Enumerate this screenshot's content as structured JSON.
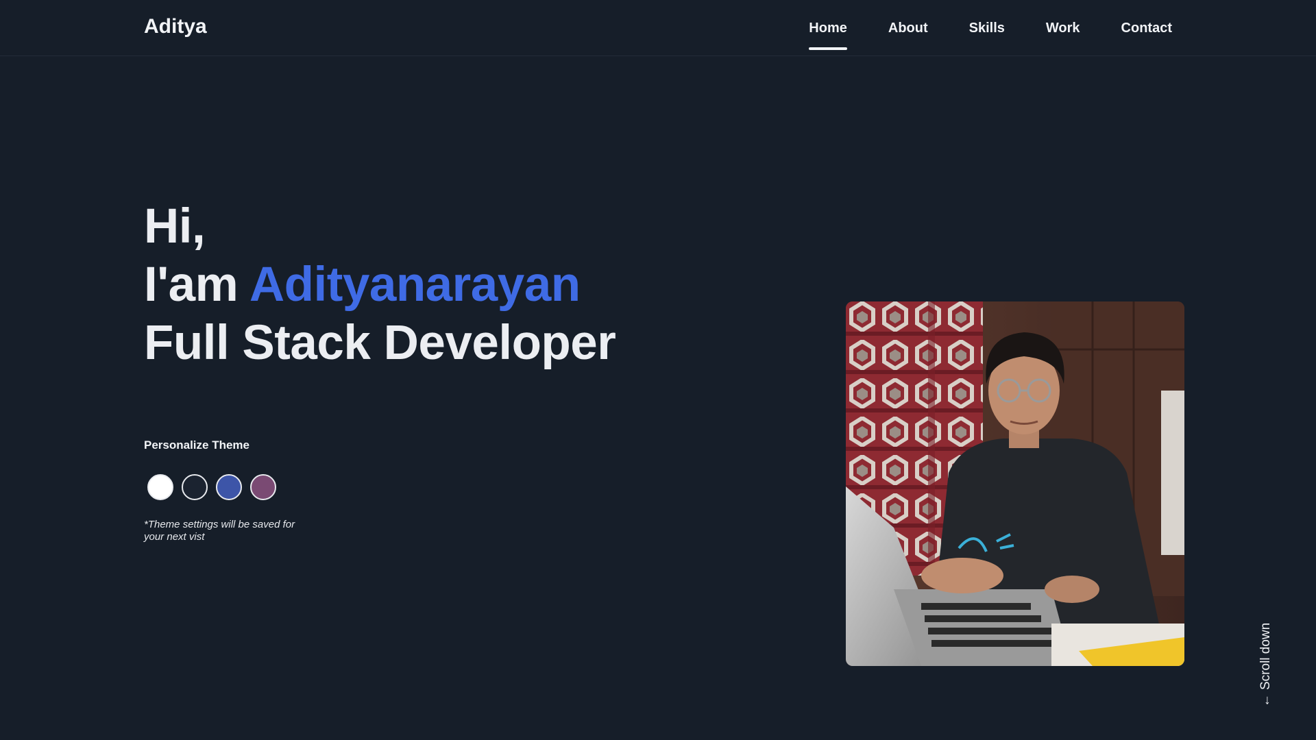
{
  "navbar": {
    "brand": "Aditya",
    "links": [
      {
        "label": "Home",
        "active": true
      },
      {
        "label": "About",
        "active": false
      },
      {
        "label": "Skills",
        "active": false
      },
      {
        "label": "Work",
        "active": false
      },
      {
        "label": "Contact",
        "active": false
      }
    ]
  },
  "hero": {
    "greeting": "Hi,",
    "intro": "I'am",
    "name": "Adityanarayan",
    "role": "Full Stack Developer"
  },
  "theme": {
    "title": "Personalize Theme",
    "note": "*Theme settings will be saved for your next vist",
    "swatches": [
      {
        "name": "white",
        "color": "#ffffff"
      },
      {
        "name": "dark",
        "color": "#1b2330"
      },
      {
        "name": "blue",
        "color": "#3d55a8"
      },
      {
        "name": "purple",
        "color": "#7a4a73"
      }
    ]
  },
  "colors": {
    "background": "#161e29",
    "accent": "#3f6be5",
    "text": "#eef0f3"
  },
  "scroll": {
    "arrow": "←",
    "label": "Scroll down"
  }
}
